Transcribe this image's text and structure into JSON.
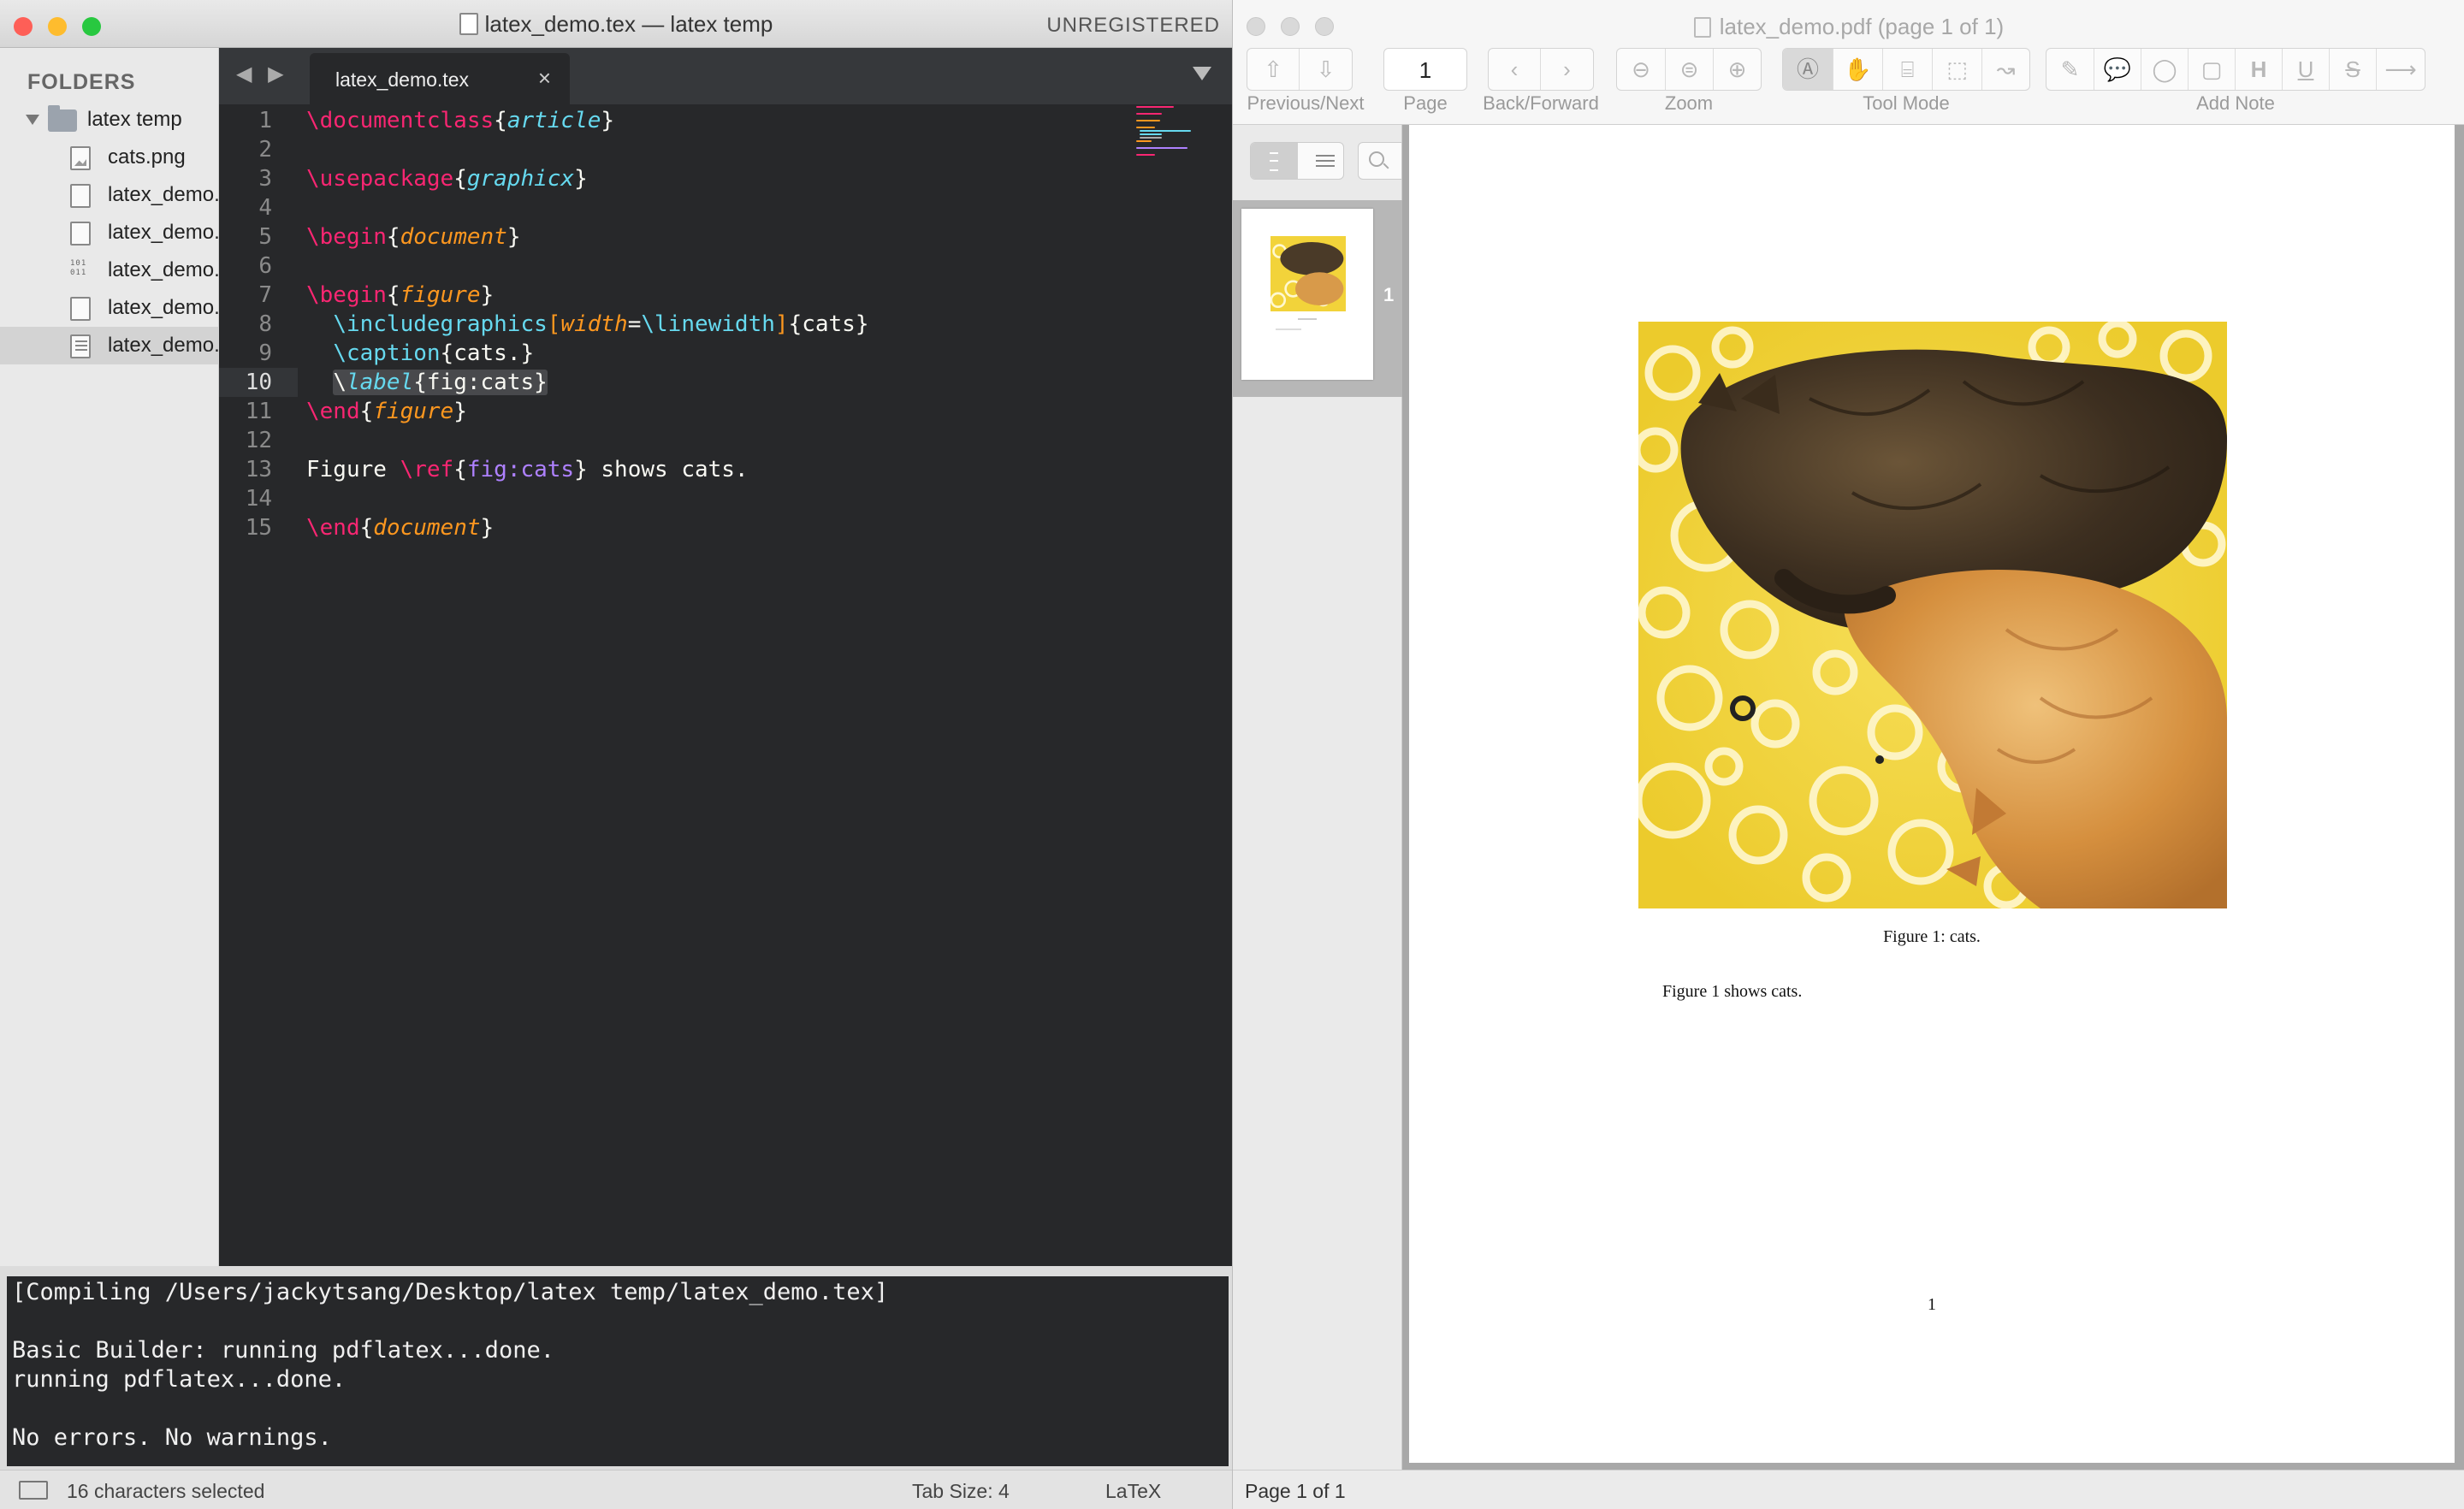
{
  "editor": {
    "window_title": "latex_demo.tex — latex temp",
    "registration": "UNREGISTERED",
    "sidebar": {
      "header": "FOLDERS",
      "folder": "latex temp",
      "files": [
        "cats.png",
        "latex_demo.",
        "latex_demo.",
        "latex_demo.",
        "latex_demo.",
        "latex_demo."
      ]
    },
    "tab": {
      "name": "latex_demo.tex",
      "close": "×"
    },
    "nav_arrows": "◀ ▶",
    "line_numbers": [
      "1",
      "2",
      "3",
      "4",
      "5",
      "6",
      "7",
      "8",
      "9",
      "10",
      "11",
      "12",
      "13",
      "14",
      "15"
    ],
    "code": {
      "l1": {
        "cmd": "\\documentclass",
        "o": "{",
        "arg": "article",
        "c": "}"
      },
      "l3": {
        "cmd": "\\usepackage",
        "o": "{",
        "arg": "graphicx",
        "c": "}"
      },
      "l5": {
        "cmd": "\\begin",
        "o": "{",
        "arg": "document",
        "c": "}"
      },
      "l7": {
        "cmd": "\\begin",
        "o": "{",
        "arg": "figure",
        "c": "}"
      },
      "l8": {
        "indent": "  ",
        "cmd": "\\includegraphics",
        "ob": "[",
        "key": "width",
        "eq": "=",
        "val": "\\linewidth",
        "cb": "]",
        "rest": "{cats}"
      },
      "l9": {
        "indent": "  ",
        "cmd": "\\caption",
        "rest": "{cats.}"
      },
      "l10": {
        "indent": "  ",
        "bs": "\\",
        "cmd": "label",
        "rest": "{fig:cats}"
      },
      "l11": {
        "cmd": "\\end",
        "o": "{",
        "arg": "figure",
        "c": "}"
      },
      "l13": {
        "pre": "Figure ",
        "cmd": "\\ref",
        "o": "{",
        "arg": "fig:cats",
        "c": "}",
        "post": " shows cats."
      },
      "l15": {
        "cmd": "\\end",
        "o": "{",
        "arg": "document",
        "c": "}"
      }
    },
    "console": [
      "[Compiling /Users/jackytsang/Desktop/latex temp/latex_demo.tex]",
      "",
      "Basic Builder: running pdflatex...done.",
      "running pdflatex...done.",
      "",
      "No errors. No warnings."
    ],
    "status": {
      "selection": "16 characters selected",
      "tab_size": "Tab Size: 4",
      "syntax": "LaTeX"
    }
  },
  "viewer": {
    "window_title": "latex_demo.pdf (page 1 of 1)",
    "toolbar": {
      "prev_next_label": "Previous/Next",
      "page_label": "Page",
      "page_value": "1",
      "back_forward_label": "Back/Forward",
      "zoom_label": "Zoom",
      "tool_mode_label": "Tool Mode",
      "add_note_label": "Add Note"
    },
    "thumbnail_page": "1",
    "document": {
      "caption": "Figure 1: cats.",
      "body": "Figure 1 shows cats.",
      "page_number": "1"
    },
    "status": "Page 1 of 1"
  },
  "colors": {
    "editor_bg": "#27282a",
    "keyword": "#f92672",
    "argument": "#fd971f",
    "builtin": "#66d9ef",
    "reference": "#ae81ff",
    "close_light": "#fe5f57",
    "minimize_light": "#febc2e",
    "zoom_light": "#28c840"
  }
}
